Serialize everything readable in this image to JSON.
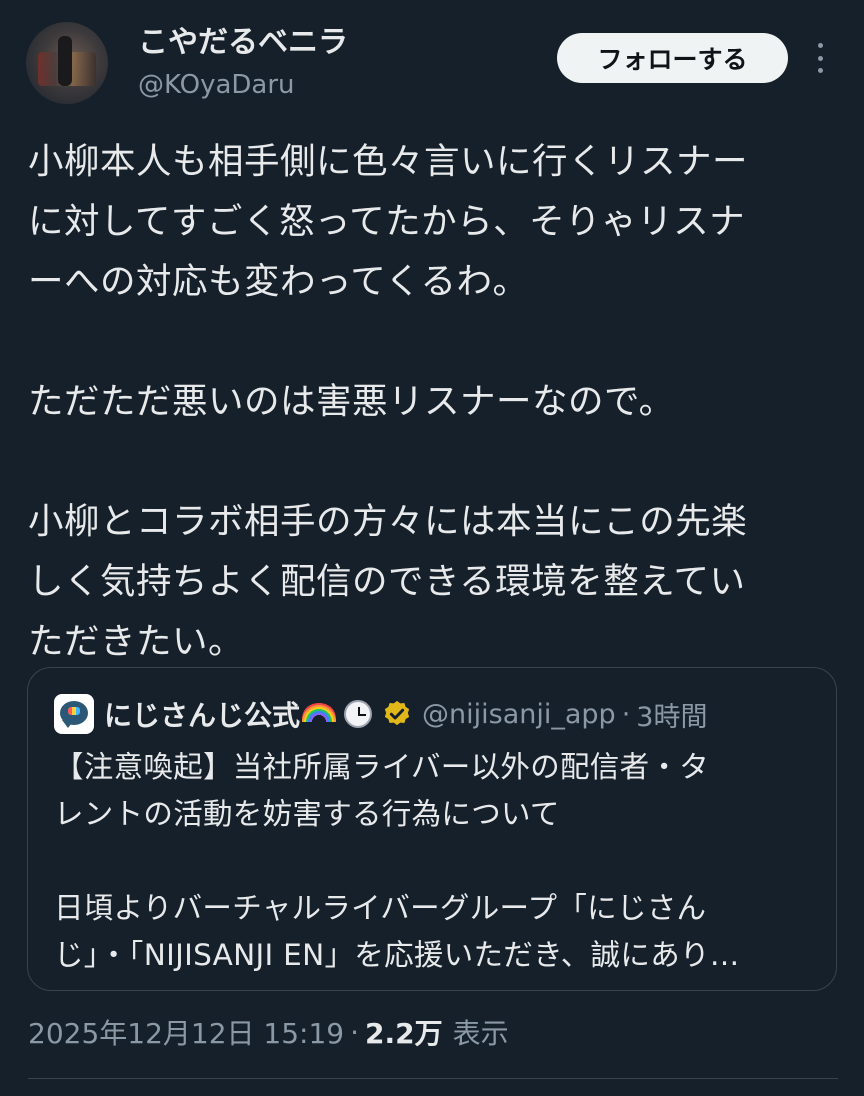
{
  "author": {
    "display_name": "こやだるベニラ",
    "handle": "@KOyaDaru"
  },
  "actions": {
    "follow_label": "フォローする",
    "more_icon": "more-vertical-icon"
  },
  "tweet": {
    "lines": [
      "小柳本人も相手側に色々言いに行くリスナー",
      "に対してすごく怒ってたから、そりゃリスナ",
      "ーへの対応も変わってくるわ。",
      "",
      "ただただ悪いのは害悪リスナーなので。",
      "",
      "小柳とコラボ相手の方々には本当にこの先楽",
      "しく気持ちよく配信のできる環境を整えてい",
      "ただきたい。"
    ]
  },
  "quote": {
    "name": "にじさんじ公式",
    "handle": "@nijisanji_app",
    "separator": "·",
    "time": "3時間",
    "icons": [
      "rainbow-icon",
      "clock-icon",
      "verified-badge-icon"
    ],
    "lines": [
      "【注意喚起】当社所属ライバー以外の配信者・タ",
      "レントの活動を妨害する行為について",
      "",
      "日頃よりバーチャルライバーグループ「にじさん",
      "じ」・「NIJISANJI EN」を応援いただき、誠にあり…"
    ]
  },
  "meta": {
    "date": "2025年12月12日 15:19",
    "separator": "·",
    "views_count": "2.2万",
    "views_label": "表示"
  }
}
